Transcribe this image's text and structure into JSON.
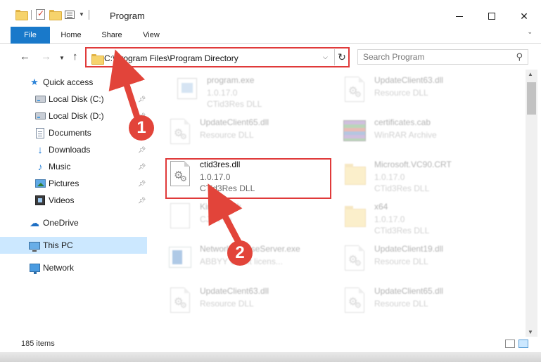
{
  "window": {
    "title": "Program",
    "controls": {
      "minimize": "minimize",
      "maximize": "maximize",
      "close": "close"
    }
  },
  "ribbon": {
    "tabs": [
      "File",
      "Home",
      "Share",
      "View"
    ]
  },
  "address_bar": {
    "path": "C:\\Program Files\\Program Directory",
    "search_placeholder": "Search Program"
  },
  "nav_pane": {
    "items": [
      {
        "label": "Quick access",
        "icon": "star-icon",
        "pinned": false
      },
      {
        "label": "Local Disk (C:)",
        "icon": "drive-icon",
        "pinned": true
      },
      {
        "label": "Local Disk (D:)",
        "icon": "drive-icon",
        "pinned": true
      },
      {
        "label": "Documents",
        "icon": "documents-icon",
        "pinned": true
      },
      {
        "label": "Downloads",
        "icon": "downloads-icon",
        "pinned": true
      },
      {
        "label": "Music",
        "icon": "music-icon",
        "pinned": true
      },
      {
        "label": "Pictures",
        "icon": "pictures-icon",
        "pinned": true
      },
      {
        "label": "Videos",
        "icon": "videos-icon",
        "pinned": true
      },
      {
        "label": "OneDrive",
        "icon": "onedrive-icon",
        "pinned": false
      },
      {
        "label": "This PC",
        "icon": "this-pc-icon",
        "pinned": false,
        "selected": true
      },
      {
        "label": "Network",
        "icon": "network-icon",
        "pinned": false
      }
    ]
  },
  "files": [
    {
      "name": "program.exe",
      "line2": "1.0.17.0",
      "line3": "CTid3Res DLL",
      "icon": "exe"
    },
    {
      "name": "UpdateClient63.dll",
      "line2": "Resource DLL",
      "line3": "",
      "icon": "dll"
    },
    {
      "name": "UpdateClient65.dll",
      "line2": "Resource DLL",
      "line3": "",
      "icon": "dll"
    },
    {
      "name": "certificates.cab",
      "line2": "WinRAR Archive",
      "line3": "",
      "icon": "archive"
    },
    {
      "name": "ctid3res.dll",
      "line2": "1.0.17.0",
      "line3": "CTid3Res DLL",
      "icon": "dll",
      "focus": true
    },
    {
      "name": "Microsoft.VC90.CRT",
      "line2": "1.0.17.0",
      "line3": "CTid3Res DLL",
      "icon": "folder"
    },
    {
      "name": "Kimgen.cjk",
      "line2": "CJK File",
      "line3": "",
      "icon": "cjk"
    },
    {
      "name": "x64",
      "line2": "1.0.17.0",
      "line3": "CTid3Res DLL",
      "icon": "folder"
    },
    {
      "name": "NetworkLicenseServer.exe",
      "line2": "ABBYY Client licens...",
      "line3": "",
      "icon": "app"
    },
    {
      "name": "UpdateClient19.dll",
      "line2": "Resource DLL",
      "line3": "",
      "icon": "dll"
    },
    {
      "name": "UpdateClient63.dll",
      "line2": "Resource DLL",
      "line3": "",
      "icon": "dll"
    },
    {
      "name": "UpdateClient65.dll",
      "line2": "Resource DLL",
      "line3": "",
      "icon": "dll"
    }
  ],
  "status": {
    "item_count": "185 items"
  },
  "callouts": [
    "1",
    "2"
  ],
  "colors": {
    "highlight": "#e03a3a",
    "callout": "#e2443a",
    "file_tab": "#1979ca",
    "selection": "#cce8ff"
  }
}
